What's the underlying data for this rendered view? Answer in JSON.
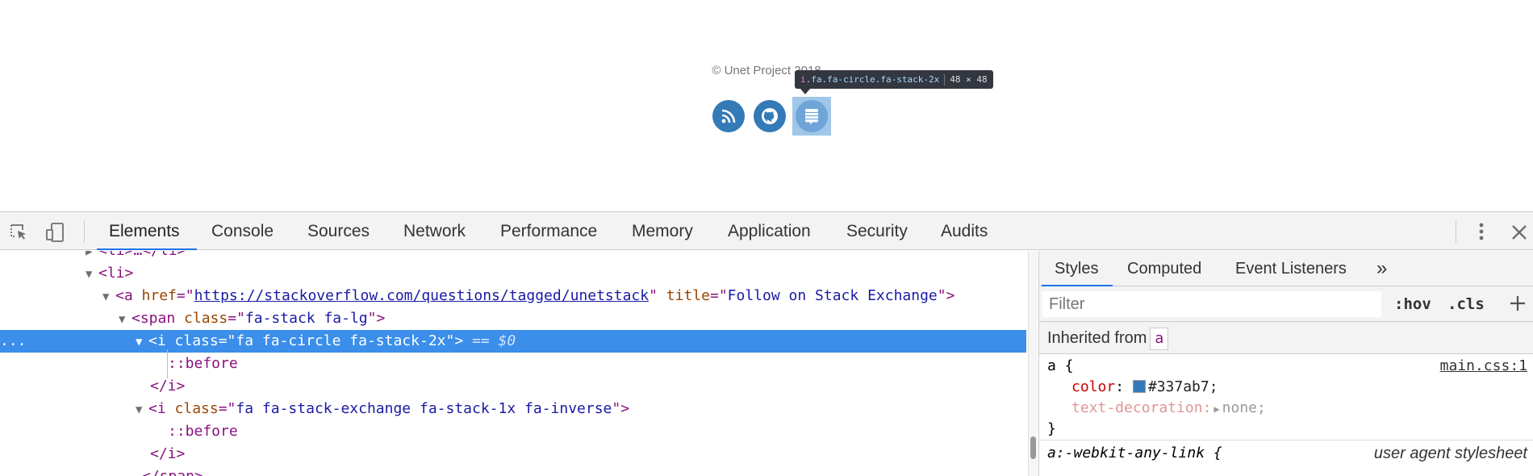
{
  "page": {
    "copyright": "© Unet Project 2018",
    "social_icons": [
      "rss-icon",
      "github-icon",
      "stack-exchange-icon"
    ],
    "accent_color": "#337ab7"
  },
  "tooltip": {
    "tag": "i",
    "classes": ".fa.fa-circle.fa-stack-2x",
    "size": "48 × 48"
  },
  "devtools": {
    "tabs": [
      "Elements",
      "Console",
      "Sources",
      "Network",
      "Performance",
      "Memory",
      "Application",
      "Security",
      "Audits"
    ],
    "active_tab": "Elements",
    "elements": {
      "lines": [
        {
          "text_open": "<",
          "tag": "li",
          "text_close": ">…</li>"
        },
        {
          "text_open": "<",
          "tag": "li",
          "text_close": ">"
        },
        {
          "tag": "a",
          "attr1": "href",
          "val1": "https://stackoverflow.com/questions/tagged/unetstack",
          "attr2": "title",
          "val2": "Follow on Stack Exchange"
        },
        {
          "tag": "span",
          "attr1": "class",
          "val1": "fa-stack fa-lg"
        },
        {
          "tag": "i",
          "attr1": "class",
          "val1": "fa fa-circle fa-stack-2x",
          "suffix": " == $0"
        },
        {
          "pseudo": "::before"
        },
        {
          "close": "</i>"
        },
        {
          "tag": "i",
          "attr1": "class",
          "val1": "fa fa-stack-exchange fa-stack-1x fa-inverse"
        },
        {
          "pseudo": "::before"
        },
        {
          "close": "</i>"
        },
        {
          "close": "</span>"
        }
      ],
      "gutter": "..."
    },
    "sidebar": {
      "tabs": [
        "Styles",
        "Computed",
        "Event Listeners",
        "»"
      ],
      "active_tab": "Styles",
      "filter_placeholder": "Filter",
      "hov": ":hov",
      "cls": ".cls",
      "inherited_label": "Inherited from",
      "inherited_tag": "a",
      "rule1": {
        "selector": "a {",
        "source": "main.css:1",
        "prop1_name": "color",
        "prop1_value": "#337ab7;",
        "prop2_name": "text-decoration",
        "prop2_value": "none;",
        "close": "}"
      },
      "rule2": {
        "selector": "a:-webkit-any-link {",
        "source": "user agent stylesheet"
      }
    }
  }
}
